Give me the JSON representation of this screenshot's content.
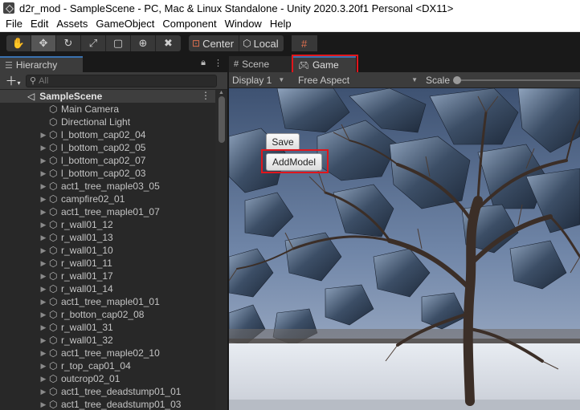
{
  "window": {
    "title": "d2r_mod - SampleScene - PC, Mac & Linux Standalone - Unity 2020.3.20f1 Personal <DX11>"
  },
  "menu": [
    "File",
    "Edit",
    "Assets",
    "GameObject",
    "Component",
    "Window",
    "Help"
  ],
  "toolbar": {
    "tools": [
      "hand-icon",
      "move-icon",
      "rotate-icon",
      "scale-icon",
      "rect-icon",
      "transform-icon",
      "custom-tool-icon"
    ],
    "pivot_label": "Center",
    "space_label": "Local"
  },
  "hierarchy": {
    "tab_label": "Hierarchy",
    "search_placeholder": "All",
    "scene_name": "SampleScene",
    "items": [
      {
        "name": "Main Camera",
        "expandable": false
      },
      {
        "name": "Directional Light",
        "expandable": false
      },
      {
        "name": "l_bottom_cap02_04",
        "expandable": true
      },
      {
        "name": "l_bottom_cap02_05",
        "expandable": true
      },
      {
        "name": "l_bottom_cap02_07",
        "expandable": true
      },
      {
        "name": "l_bottom_cap02_03",
        "expandable": true
      },
      {
        "name": "act1_tree_maple03_05",
        "expandable": true
      },
      {
        "name": "campfire02_01",
        "expandable": true
      },
      {
        "name": "act1_tree_maple01_07",
        "expandable": true
      },
      {
        "name": "r_wall01_12",
        "expandable": true
      },
      {
        "name": "r_wall01_13",
        "expandable": true
      },
      {
        "name": "r_wall01_10",
        "expandable": true
      },
      {
        "name": "r_wall01_11",
        "expandable": true
      },
      {
        "name": "r_wall01_17",
        "expandable": true
      },
      {
        "name": "r_wall01_14",
        "expandable": true
      },
      {
        "name": "act1_tree_maple01_01",
        "expandable": true
      },
      {
        "name": "r_botton_cap02_08",
        "expandable": true
      },
      {
        "name": "r_wall01_31",
        "expandable": true
      },
      {
        "name": "r_wall01_32",
        "expandable": true
      },
      {
        "name": "act1_tree_maple02_10",
        "expandable": true
      },
      {
        "name": "r_top_cap01_04",
        "expandable": true
      },
      {
        "name": "outcrop02_01",
        "expandable": true
      },
      {
        "name": "act1_tree_deadstump01_01",
        "expandable": true
      },
      {
        "name": "act1_tree_deadstump01_03",
        "expandable": true
      }
    ]
  },
  "game_view": {
    "scene_tab_label": "Scene",
    "game_tab_label": "Game",
    "display_label": "Display 1",
    "aspect_label": "Free Aspect",
    "scale_label": "Scale",
    "scale_value": 0,
    "buttons": {
      "save_label": "Save",
      "add_model_label": "AddModel"
    }
  },
  "colors": {
    "highlight_box": "#e0161c",
    "tab_accent": "#3a72b0",
    "editor_bg": "#282828"
  }
}
